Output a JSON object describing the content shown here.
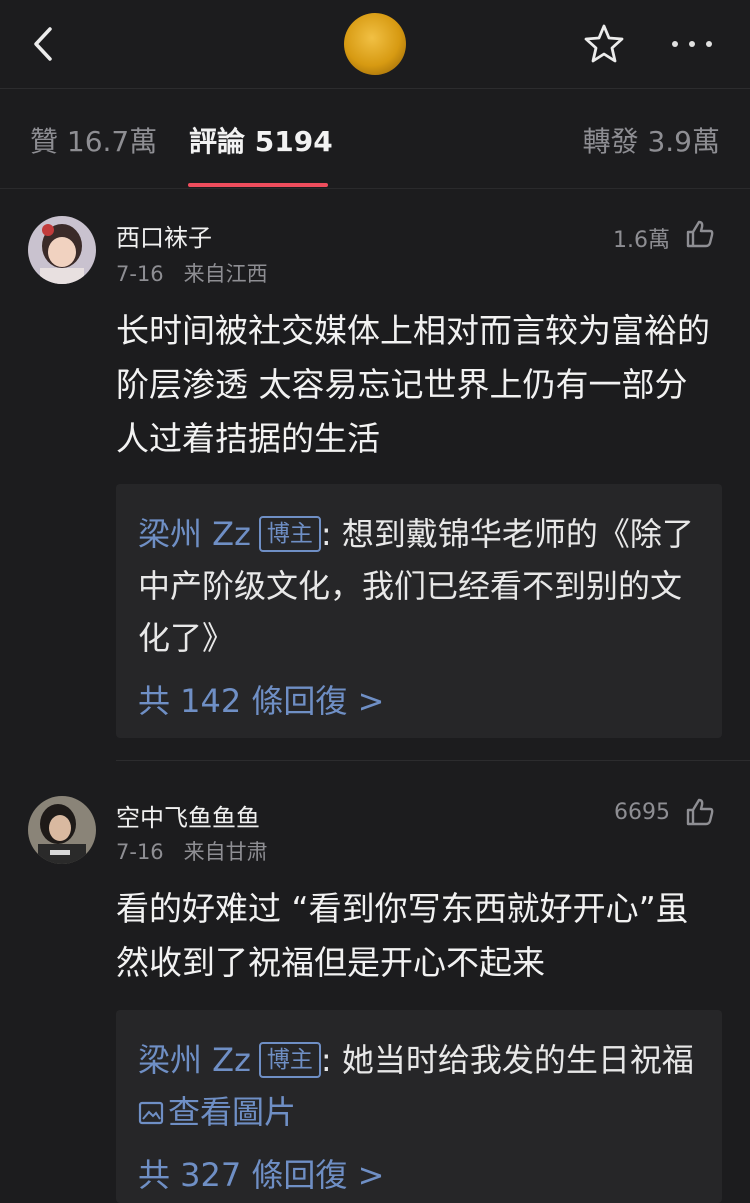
{
  "tabs": {
    "likes_label": "贊 16.7萬",
    "comments_label": "評論 5194",
    "reposts_label": "轉發 3.9萬"
  },
  "comments": [
    {
      "username": "西口袜子",
      "date": "7-16",
      "location": "来自江西",
      "likes": "1.6萬",
      "text": "长时间被社交媒体上相对而言较为富裕的阶层渗透 太容易忘记世界上仍有一部分人过着拮据的生活",
      "reply": {
        "author": "梁州 Zz",
        "badge": "博主",
        "text": ": 想到戴锦华老师的《除了中产阶级文化，我们已经看不到别的文化了》",
        "count_label": "共 142 條回復 >"
      }
    },
    {
      "username": "空中飞鱼鱼鱼",
      "date": "7-16",
      "location": "来自甘肃",
      "likes": "6695",
      "text": "看的好难过 “看到你写东西就好开心”虽然收到了祝福但是开心不起来",
      "reply": {
        "author": "梁州 Zz",
        "badge": "博主",
        "text": ": 她当时给我发的生日祝福 ",
        "image_link": "查看圖片",
        "count_label": "共 327 條回復 >"
      }
    }
  ],
  "colors": {
    "background": "#1c1c1e",
    "accent_link": "#6f8fc5",
    "tab_underline": "#ef4d5d"
  }
}
